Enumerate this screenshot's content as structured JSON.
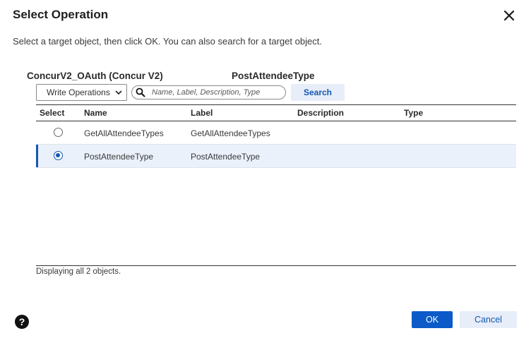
{
  "dialog": {
    "title": "Select Operation",
    "instructions": "Select a target object, then click OK. You can also search for a target object."
  },
  "connection": {
    "name": "ConcurV2_OAuth (Concur V2)",
    "selected_target": "PostAttendeeType"
  },
  "toolbar": {
    "operation_type": "Write Operations",
    "search_placeholder": "Name, Label, Description, Type",
    "search_value": "",
    "search_label": "Search"
  },
  "table": {
    "columns": [
      "Select",
      "Name",
      "Label",
      "Description",
      "Type"
    ],
    "rows": [
      {
        "name": "GetAllAttendeeTypes",
        "label": "GetAllAttendeeTypes",
        "description": "",
        "type": "",
        "selected": false
      },
      {
        "name": "PostAttendeeType",
        "label": "PostAttendeeType",
        "description": "",
        "type": "",
        "selected": true
      }
    ]
  },
  "status": "Displaying all 2 objects.",
  "footer": {
    "ok_label": "OK",
    "cancel_label": "Cancel",
    "help_symbol": "?"
  },
  "colors": {
    "accent": "#0b5ac8",
    "selected_row_bg": "#eaf1fb",
    "secondary_button_bg": "#e7eef9"
  },
  "icons": {
    "close": "close-icon",
    "dropdown": "chevron-down-icon",
    "search": "search-icon",
    "help": "help-icon"
  }
}
